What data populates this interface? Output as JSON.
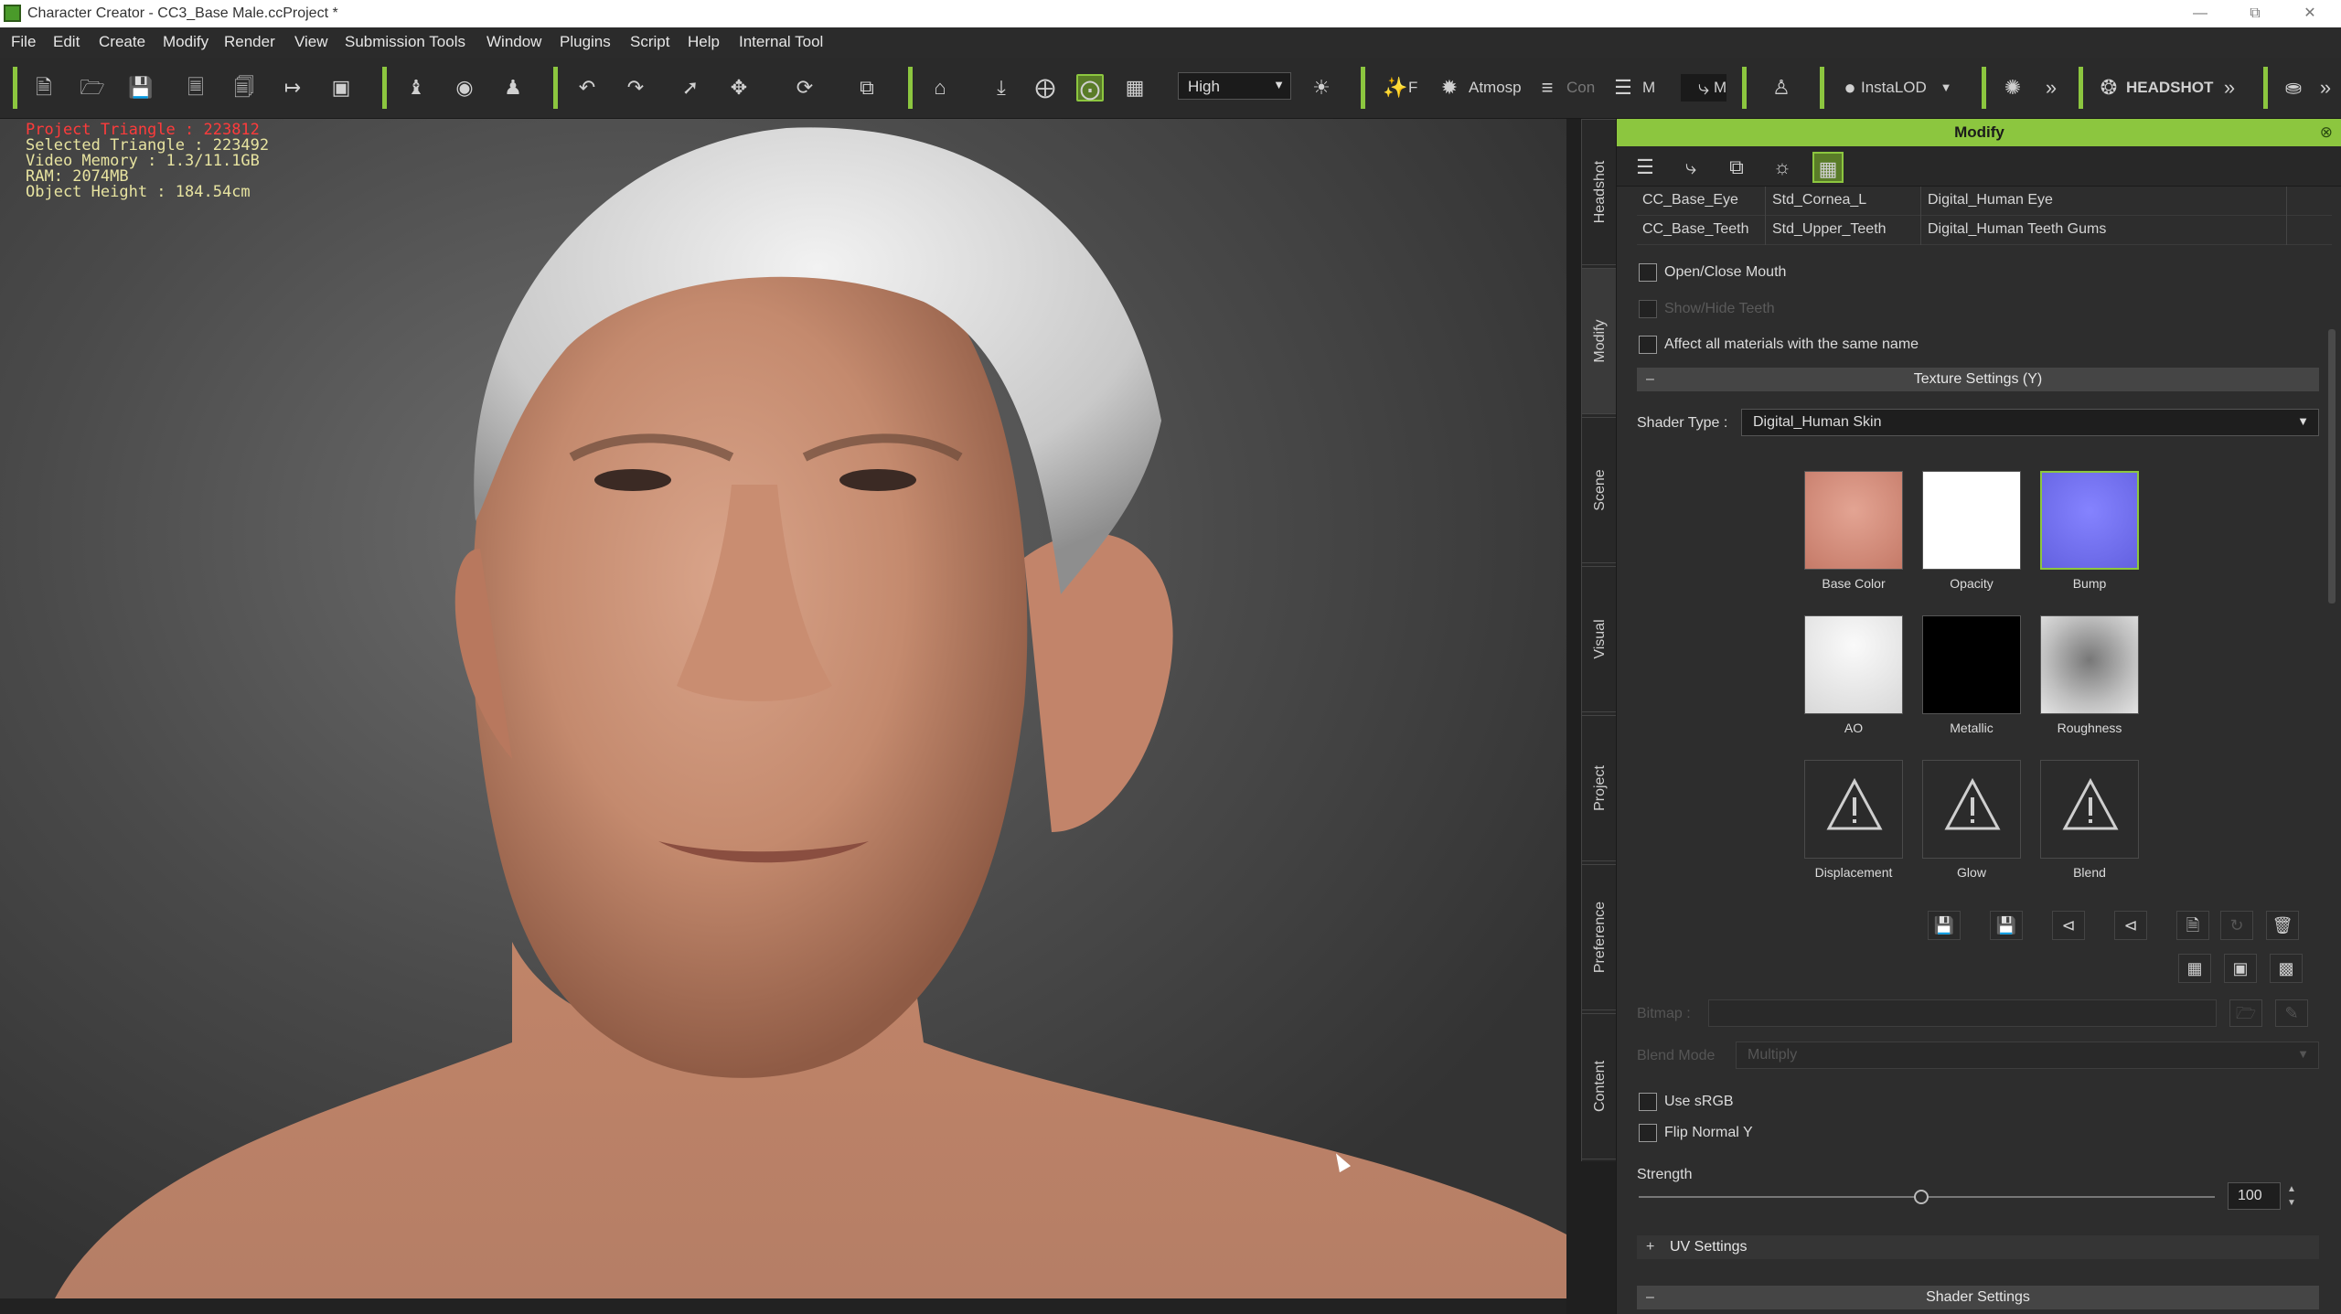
{
  "window": {
    "title": "Character Creator - CC3_Base Male.ccProject *"
  },
  "menu": [
    "File",
    "Edit",
    "Create",
    "Modify",
    "Render",
    "View",
    "Submission Tools",
    "Window",
    "Plugins",
    "Script",
    "Help",
    "Internal Tool"
  ],
  "toolbar": {
    "quality": "High",
    "atmosphere_label": "Atmosp",
    "con_label": "Con",
    "m1_label": "M",
    "m2_label": "M",
    "f_label": "F",
    "instalod_label": "InstaLOD",
    "headshot_label": "HEADSHOT"
  },
  "viewport": {
    "stats": [
      {
        "label": "Project Triangle",
        "value": "223812"
      },
      {
        "label": "Selected Triangle",
        "value": "223492"
      },
      {
        "label": "Video Memory",
        "value": "1.3/11.1GB"
      },
      {
        "label": "RAM",
        "value": "2074MB"
      },
      {
        "label": "Object Height",
        "value": "184.54cm"
      }
    ]
  },
  "side_tabs": [
    "Headshot",
    "Modify",
    "Scene",
    "Visual",
    "Project",
    "Preference",
    "Content"
  ],
  "panel": {
    "title": "Modify",
    "materials": [
      {
        "object": "CC_Base_Eye",
        "material": "Std_Cornea_L",
        "shader": "Digital_Human Eye"
      },
      {
        "object": "CC_Base_Teeth",
        "material": "Std_Upper_Teeth",
        "shader": "Digital_Human Teeth Gums"
      }
    ],
    "checkboxes": {
      "open_close_mouth": "Open/Close Mouth",
      "show_hide_teeth": "Show/Hide Teeth",
      "affect_all": "Affect all materials with the same name"
    },
    "texture_settings": "Texture Settings  (Y)",
    "shader_type_label": "Shader Type :",
    "shader_type_value": "Digital_Human Skin",
    "textures": [
      "Base Color",
      "Opacity",
      "Bump",
      "AO",
      "Metallic",
      "Roughness",
      "Displacement",
      "Glow",
      "Blend"
    ],
    "bitmap_label": "Bitmap :",
    "blend_mode_label": "Blend Mode",
    "blend_mode_value": "Multiply",
    "use_srgb": "Use sRGB",
    "flip_normal": "Flip Normal Y",
    "strength_label": "Strength",
    "strength_value": "100",
    "strength_fraction": 0.49,
    "uv_settings": "UV Settings",
    "shader_settings": "Shader Settings"
  },
  "colors": {
    "accent": "#8cc63f",
    "stats_text": "#e7e3a0",
    "stats_alert": "#ff3b3b",
    "bump_map": "#7a78f0"
  },
  "icons": [
    "new-file-icon",
    "open-file-icon",
    "save-icon",
    "undo-icon",
    "redo-icon",
    "select-arrow-icon",
    "move-icon",
    "rotate-icon",
    "scale-icon",
    "home-icon",
    "sun-icon",
    "warning-icon",
    "close-icon"
  ]
}
